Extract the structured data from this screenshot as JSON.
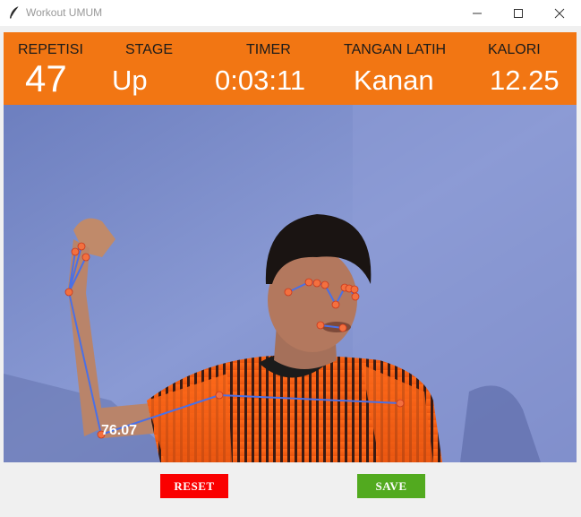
{
  "window": {
    "title": "Workout UMUM"
  },
  "stats": {
    "repetisi": {
      "label": "REPETISI",
      "value": "47"
    },
    "stage": {
      "label": "STAGE",
      "value": "Up"
    },
    "timer": {
      "label": "TIMER",
      "value": "0:03:11"
    },
    "tangan": {
      "label": "TANGAN  LATIH",
      "value": "Kanan"
    },
    "kalori": {
      "label": "KALORI",
      "value": "12.25"
    }
  },
  "camera": {
    "angle_text": "76.07"
  },
  "buttons": {
    "reset": "RESET",
    "save": "SAVE"
  },
  "colors": {
    "header": "#f27613",
    "reset": "#fa0000",
    "save": "#52aa1f",
    "landmark": "#f3703f",
    "skeleton": "#4a70e6"
  }
}
